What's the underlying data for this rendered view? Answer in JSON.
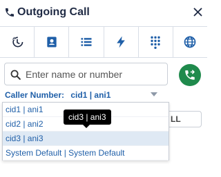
{
  "header": {
    "title": "Outgoing Call",
    "icon": "phone-icon",
    "close_icon": "close-icon"
  },
  "tabs": [
    {
      "icon": "history-icon",
      "active": true
    },
    {
      "icon": "contacts-icon",
      "active": false
    },
    {
      "icon": "list-icon",
      "active": false
    },
    {
      "icon": "lightning-icon",
      "active": false
    },
    {
      "icon": "dialpad-icon",
      "active": false
    },
    {
      "icon": "globe-icon",
      "active": false
    }
  ],
  "search": {
    "placeholder": "Enter name or number",
    "value": ""
  },
  "caller": {
    "label": "Caller Number:",
    "value": "cid1 | ani1"
  },
  "background_button": {
    "label": "LL"
  },
  "dropdown": {
    "options": [
      "cid1 | ani1",
      "cid2 | ani2",
      "cid3 | ani3",
      "System Default | System Default"
    ],
    "highlighted_index": 2
  },
  "tooltip": {
    "text": "cid3 | ani3"
  },
  "colors": {
    "accent_blue": "#1f5fa8",
    "call_green": "#1f8a4c",
    "title_dark": "#1f2a44"
  }
}
